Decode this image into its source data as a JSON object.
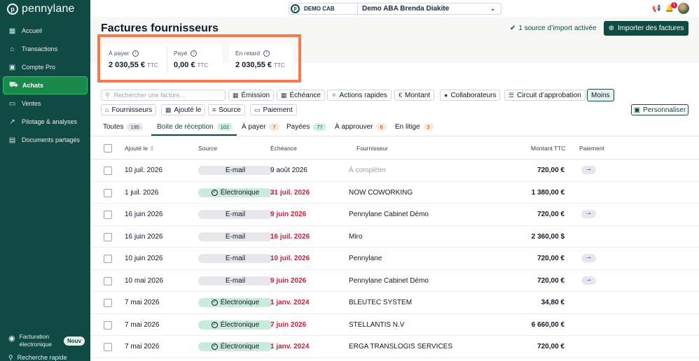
{
  "sidebar": {
    "logo": "pennylane",
    "items": [
      {
        "label": "Accueil",
        "icon": "dashboard-icon"
      },
      {
        "label": "Transactions",
        "icon": "bank-icon"
      },
      {
        "label": "Compte Pro",
        "icon": "card-icon"
      },
      {
        "label": "Achats",
        "icon": "cart-icon",
        "active": true
      },
      {
        "label": "Ventes",
        "icon": "sales-icon"
      },
      {
        "label": "Pilotage & analyses",
        "icon": "chart-icon"
      },
      {
        "label": "Documents partagés",
        "icon": "folder-icon"
      }
    ],
    "facturation_line1": "Facturation",
    "facturation_line2": "électronique",
    "nouv": "Nouv",
    "recherche": "Recherche rapide"
  },
  "topbar": {
    "cab": "DEMO CAB",
    "company": "Demo ABA Brenda Diakite",
    "notif_count": "1"
  },
  "header": {
    "title": "Factures fournisseurs",
    "source_info": "1 source d’import activée",
    "import_button": "Importer des factures"
  },
  "summary": {
    "a_payer": {
      "label": "À payer",
      "value": "2 030,55 €",
      "suffix": "TTC"
    },
    "paye": {
      "label": "Payé",
      "value": "0,00 €",
      "suffix": "TTC"
    },
    "en_retard": {
      "label": "En retard",
      "value": "2 030,55 €",
      "suffix": "TTC"
    }
  },
  "search": {
    "placeholder": "Rechercher une facture..."
  },
  "filters": {
    "emission": "Émission",
    "echeance": "Échéance",
    "actions": "Actions rapides",
    "montant": "Montant",
    "collaborateurs": "Collaborateurs",
    "circuit": "Circuit d’approbation",
    "moins": "Moins",
    "fournisseurs": "Fournisseurs",
    "ajoute": "Ajouté le",
    "source": "Source",
    "paiement": "Paiement",
    "personnaliser": "Personnaliser"
  },
  "tabs": [
    {
      "label": "Toutes",
      "count": "195"
    },
    {
      "label": "Boite de réception",
      "count": "102"
    },
    {
      "label": "À payer",
      "count": "7"
    },
    {
      "label": "Payées",
      "count": "77"
    },
    {
      "label": "À approuver",
      "count": "6"
    },
    {
      "label": "En litige",
      "count": "2"
    }
  ],
  "columns": {
    "ajoute": "Ajouté le",
    "source": "Source",
    "echeance": "Échéance",
    "fournisseur": "Fournisseur",
    "montant": "Montant TTC",
    "paiement": "Paiement"
  },
  "rows": [
    {
      "ajoute": "10 juil. 2026",
      "source": "E-mail",
      "echeance": "9 août 2026",
      "fournisseur": "À compléter",
      "montant": "720,00 €"
    },
    {
      "ajoute": "1 juil. 2026",
      "source": "Électronique",
      "echeance": "31 juil. 2026",
      "fournisseur": "NOW COWORKING",
      "montant": "1 380,00 €"
    },
    {
      "ajoute": "16 juin 2026",
      "source": "E-mail",
      "echeance": "9 juin 2026",
      "fournisseur": "Pennylane Cabinet Démo",
      "montant": "720,00 €"
    },
    {
      "ajoute": "16 juin 2026",
      "source": "E-mail",
      "echeance": "16 juil. 2026",
      "fournisseur": "Miro",
      "montant": "2 360,00 $"
    },
    {
      "ajoute": "10 juin 2026",
      "source": "E-mail",
      "echeance": "10 juil. 2026",
      "fournisseur": "Pennylane",
      "montant": "720,00 €"
    },
    {
      "ajoute": "10 mai 2026",
      "source": "E-mail",
      "echeance": "9 juin 2026",
      "fournisseur": "Pennylane Cabinet Démo",
      "montant": "720,00 €"
    },
    {
      "ajoute": "7 mai 2026",
      "source": "Électronique",
      "echeance": "1 janv. 2024",
      "fournisseur": "BLEUTEC SYSTEM",
      "montant": "34,80 €"
    },
    {
      "ajoute": "7 mai 2026",
      "source": "Électronique",
      "echeance": "7 juin 2026",
      "fournisseur": "STELLANTIS N.V",
      "montant": "6 660,00 €"
    },
    {
      "ajoute": "7 mai 2026",
      "source": "Électronique",
      "echeance": "1 janv. 2024",
      "fournisseur": "ERGA TRANSLOGIS SERVICES",
      "montant": "720,00 €"
    }
  ],
  "pay_icon": "⇀"
}
